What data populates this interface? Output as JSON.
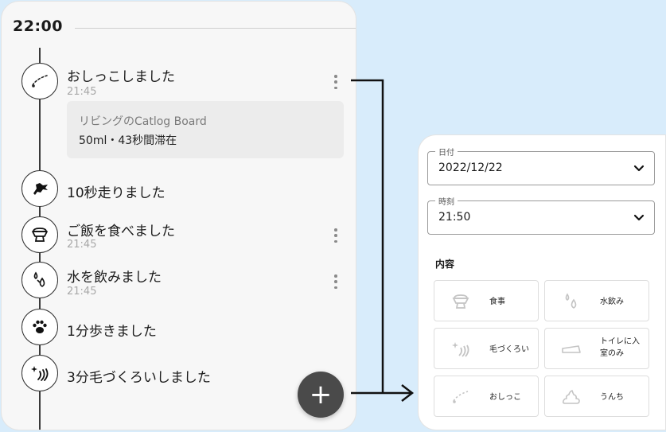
{
  "timeline": {
    "time_header": "22:00",
    "entries": [
      {
        "title": "おしっこしました",
        "time": "21:45",
        "icon": "pee-icon"
      },
      {
        "title": "10秒走りました",
        "time": "",
        "icon": "running-cat-icon"
      },
      {
        "title": "ご飯を食べました",
        "time": "21:45",
        "icon": "food-bowl-icon"
      },
      {
        "title": "水を飲みました",
        "time": "21:45",
        "icon": "water-drops-icon"
      },
      {
        "title": "1分歩きました",
        "time": "",
        "icon": "paw-icon"
      },
      {
        "title": "3分毛づくろいしました",
        "time": "",
        "icon": "grooming-icon"
      }
    ],
    "detail": {
      "device": "リビングのCatlog Board",
      "stats": "50ml・43秒間滞在"
    },
    "fab_label": "+"
  },
  "form": {
    "date_label": "日付",
    "date_value": "2022/12/22",
    "time_label": "時刻",
    "time_value": "21:50",
    "content_label": "内容",
    "options": [
      {
        "label": "食事",
        "icon": "food-bowl-icon"
      },
      {
        "label": "水飲み",
        "icon": "water-drops-icon"
      },
      {
        "label": "毛づくろい",
        "icon": "grooming-icon"
      },
      {
        "label_line1": "トイレに入",
        "label_line2": "室のみ",
        "icon": "toilet-icon"
      },
      {
        "label": "おしっこ",
        "icon": "pee-icon"
      },
      {
        "label": "うんち",
        "icon": "poop-icon"
      }
    ]
  },
  "colors": {
    "background": "#d8ecfb",
    "fab": "#4a4a4a",
    "timeline_line": "#3a3a3a",
    "muted_text": "#a8a8a8"
  }
}
